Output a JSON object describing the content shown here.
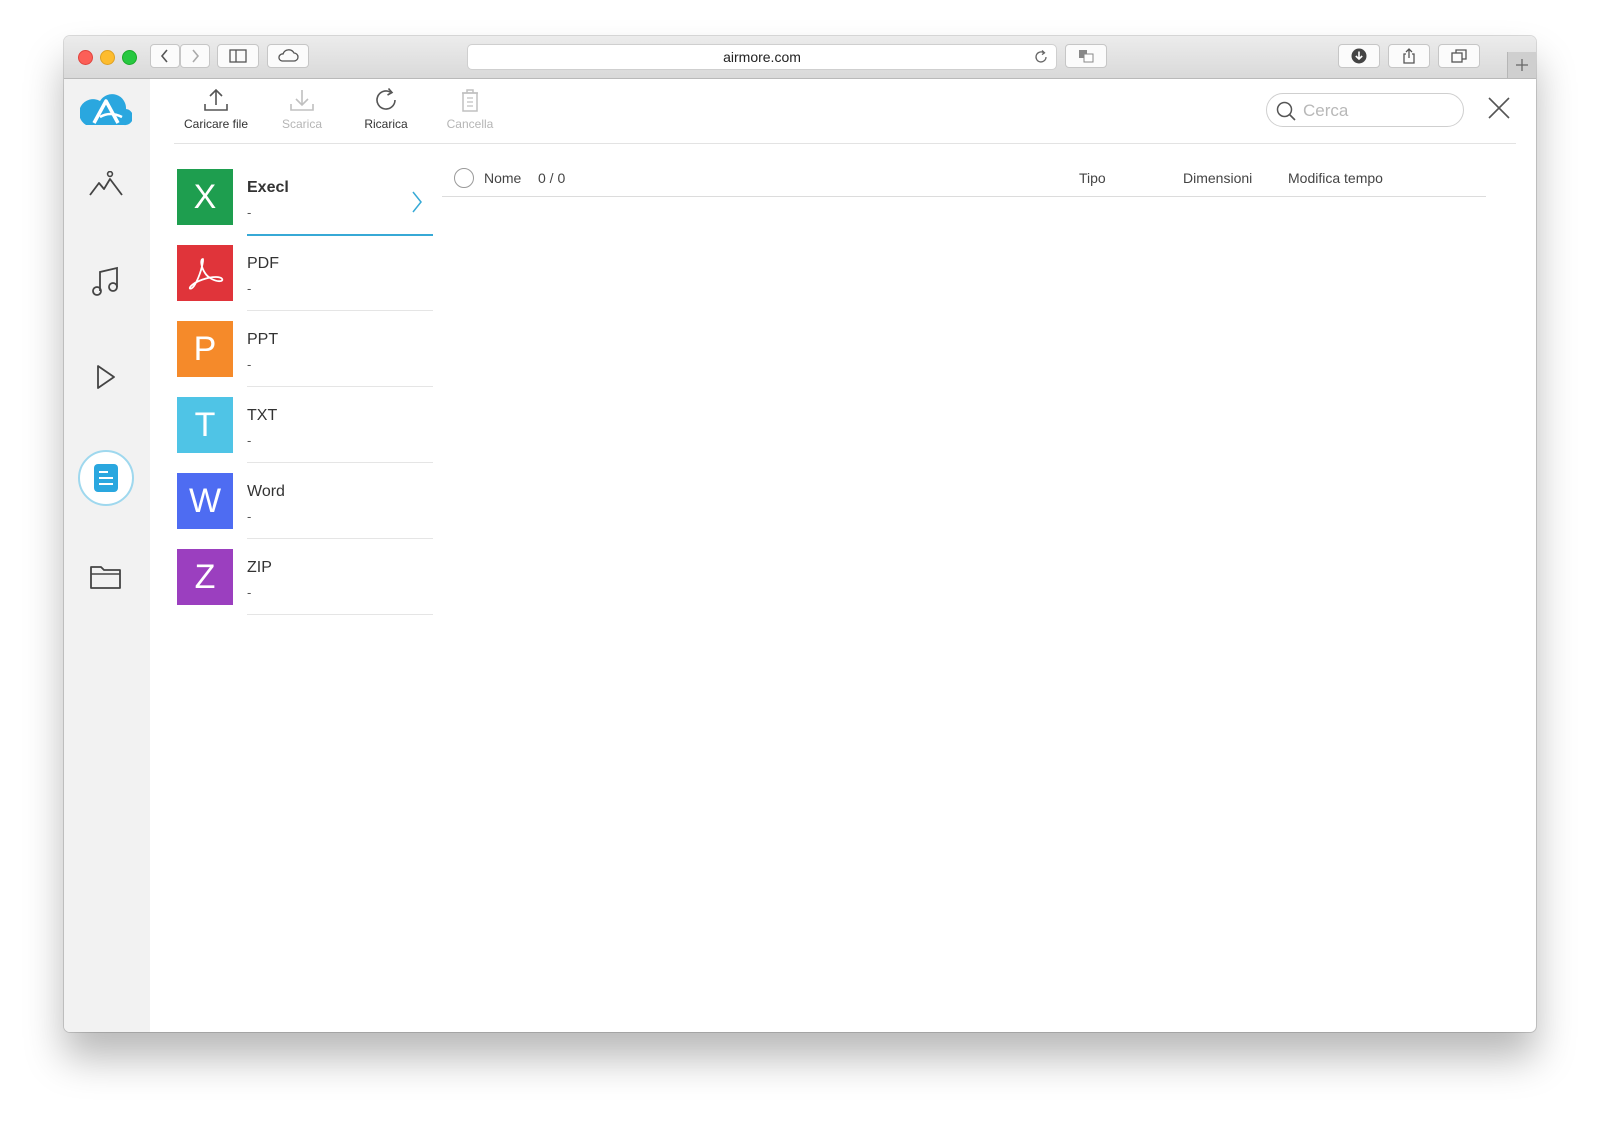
{
  "browser": {
    "url": "airmore.com"
  },
  "toolbar": {
    "upload_label": "Caricare file",
    "download_label": "Scarica",
    "reload_label": "Ricarica",
    "delete_label": "Cancella",
    "search_placeholder": "Cerca"
  },
  "file_types": [
    {
      "letter": "X",
      "name": "Execl",
      "count": "-",
      "color": "#1e9e4f"
    },
    {
      "letter": "",
      "name": "PDF",
      "count": "-",
      "color": "#e0343a"
    },
    {
      "letter": "P",
      "name": "PPT",
      "count": "-",
      "color": "#f58a2a"
    },
    {
      "letter": "T",
      "name": "TXT",
      "count": "-",
      "color": "#4fc4e6"
    },
    {
      "letter": "W",
      "name": "Word",
      "count": "-",
      "color": "#4e6cf2"
    },
    {
      "letter": "Z",
      "name": "ZIP",
      "count": "-",
      "color": "#9b3fbf"
    }
  ],
  "table": {
    "name_header": "Nome",
    "selection_count": "0 / 0",
    "type_header": "Tipo",
    "size_header": "Dimensioni",
    "modified_header": "Modifica tempo"
  },
  "colors": {
    "accent": "#37a9d6",
    "sidebar_bg": "#f2f2f2"
  }
}
